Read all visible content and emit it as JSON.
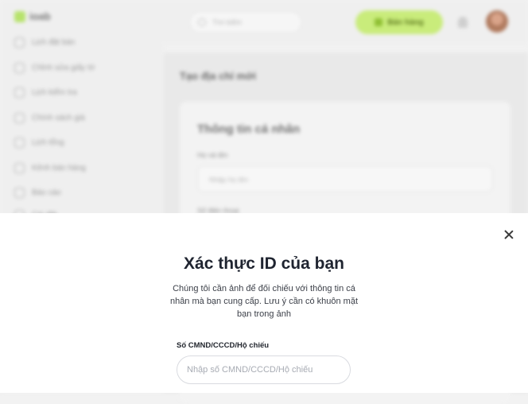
{
  "background": {
    "logo_text": "ioab",
    "search_placeholder": "Tìm kiếm",
    "cta_label": "Bán hàng",
    "sidebar_items": [
      {
        "label": "Lịch đặt bàn",
        "icon": "calendar-icon"
      },
      {
        "label": "Chỉnh sửa giấy tờ",
        "icon": "edit-icon"
      },
      {
        "label": "Lịch kiểm tra",
        "icon": "checklist-icon"
      },
      {
        "label": "Chính sách giá",
        "icon": "tag-icon"
      },
      {
        "label": "Lịch tổng",
        "icon": "clock-icon"
      },
      {
        "label": "Kênh bán hàng",
        "icon": "store-icon"
      },
      {
        "label": "Báo cáo",
        "icon": "chart-icon"
      },
      {
        "label": "Cài đặt",
        "icon": "gear-icon"
      }
    ],
    "main_title": "Tạo địa chỉ mới",
    "card_title": "Thông tin cá nhân",
    "fields": [
      {
        "label": "Họ và tên",
        "placeholder": "Nhập họ tên"
      },
      {
        "label": "Số điện thoại",
        "placeholder": ""
      }
    ]
  },
  "modal": {
    "title": "Xác thực ID của bạn",
    "description": "Chúng tôi cần ảnh để đối chiếu với thông tin cá nhân mà bạn cung cấp. Lưu ý cần có khuôn mặt bạn trong ảnh",
    "id_field": {
      "label": "Số CMND/CCCD/Hộ chiếu",
      "placeholder": "Nhập số CMND/CCCD/Hộ chiếu",
      "value": ""
    }
  },
  "colors": {
    "accent": "#c9ec7b",
    "title_text": "#1f2430",
    "sheet_background": "#ffffff"
  }
}
